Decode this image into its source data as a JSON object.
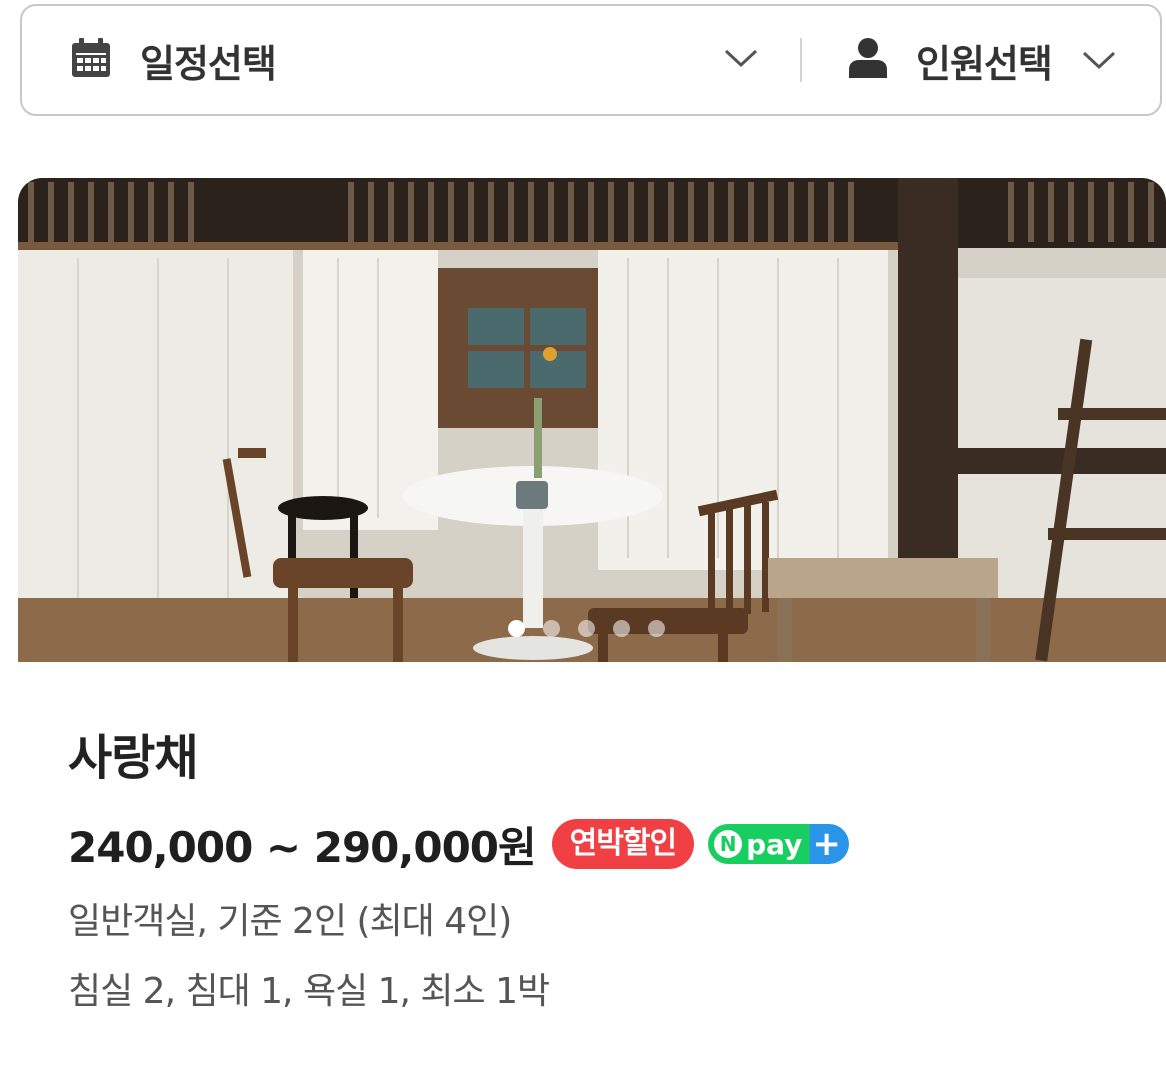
{
  "selector": {
    "date_label": "일정선택",
    "people_label": "인원선택"
  },
  "room": {
    "name": "사랑채",
    "price": "240,000 ~ 290,000원",
    "badges": {
      "sale": "연박할인",
      "npay_n": "N",
      "npay_text": "pay",
      "npay_plus": "+"
    },
    "detail_line_1": "일반객실, 기준 2인 (최대 4인)",
    "detail_line_2": "침실 2, 침대 1, 욕실 1, 최소 1박"
  },
  "carousel": {
    "slide_count": 5,
    "active_index": 0
  },
  "colors": {
    "sale_badge": "#f04044",
    "npay_green": "#19ce60",
    "npay_blue": "#2a95e8",
    "border": "#c8c8c8"
  },
  "icons": {
    "date": "calendar-icon",
    "people": "person-icon",
    "dropdown": "chevron-down-icon"
  }
}
